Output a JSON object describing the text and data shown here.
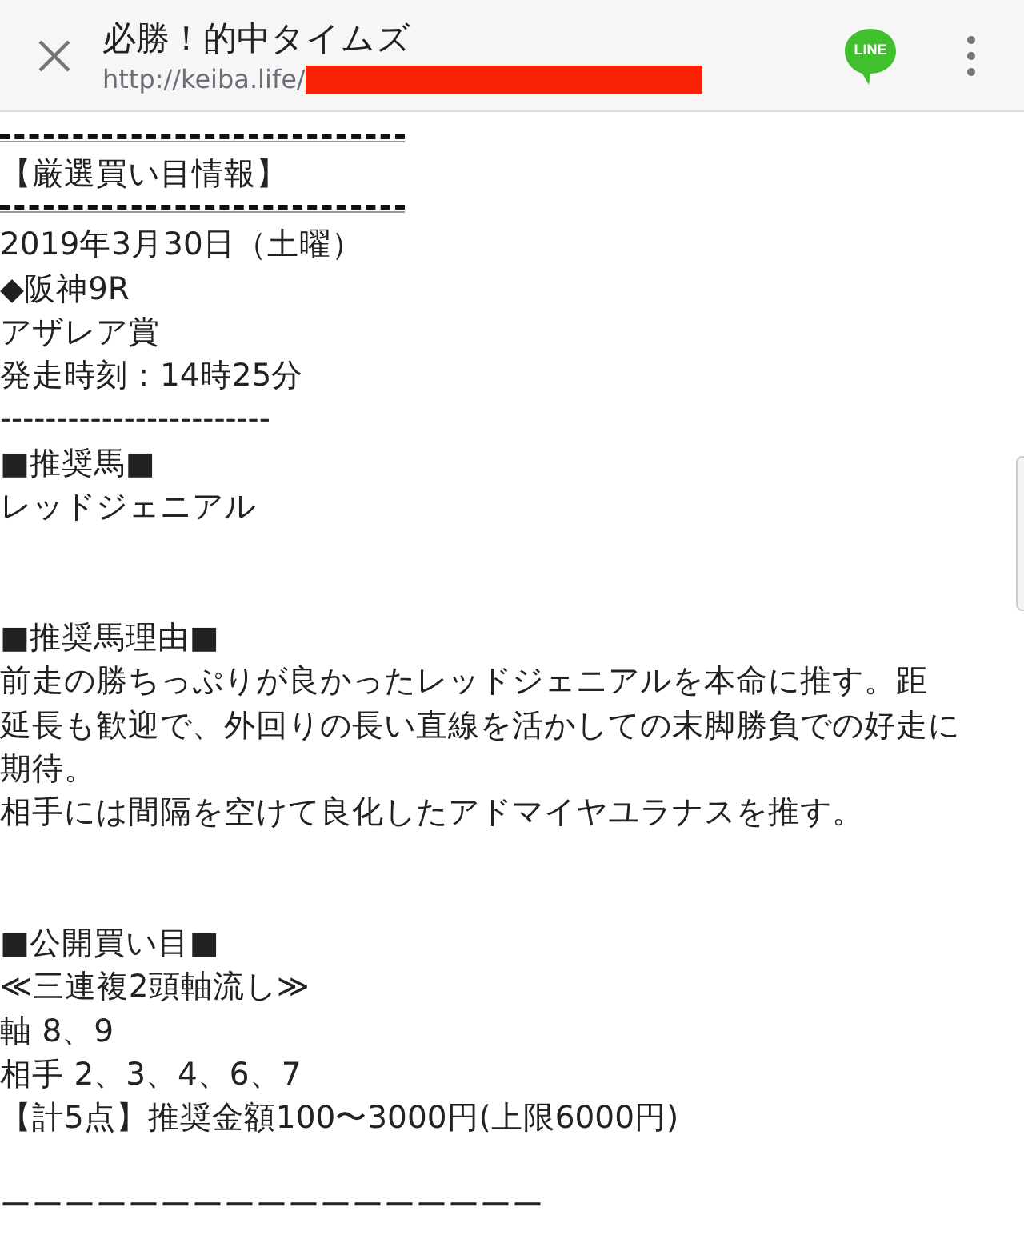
{
  "header": {
    "title": "必勝！的中タイムズ",
    "url": "http://keiba.life/",
    "share_label": "LINE"
  },
  "content": [
    {
      "kind": "dash_rule"
    },
    {
      "kind": "text",
      "text": "【厳選買い目情報】"
    },
    {
      "kind": "dash_rule"
    },
    {
      "kind": "text",
      "text": "2019年3月30日（土曜）"
    },
    {
      "kind": "text",
      "text": "◆阪神9R"
    },
    {
      "kind": "text",
      "text": "アザレア賞"
    },
    {
      "kind": "text",
      "text": "発走時刻：14時25分"
    },
    {
      "kind": "text",
      "text": "------------------------"
    },
    {
      "kind": "text",
      "text": "■推奨馬■"
    },
    {
      "kind": "text",
      "text": "レッドジェニアル"
    },
    {
      "kind": "blank"
    },
    {
      "kind": "blank"
    },
    {
      "kind": "text",
      "text": "■推奨馬理由■"
    },
    {
      "kind": "text",
      "text": "前走の勝ちっぷりが良かったレッドジェニアルを本命に推す。距"
    },
    {
      "kind": "text",
      "text": "延長も歓迎で、外回りの長い直線を活かしての末脚勝負での好走に"
    },
    {
      "kind": "text",
      "text": "期待。"
    },
    {
      "kind": "text",
      "text": "相手には間隔を空けて良化したアドマイヤユラナスを推す。"
    },
    {
      "kind": "blank"
    },
    {
      "kind": "blank"
    },
    {
      "kind": "text",
      "text": "■公開買い目■"
    },
    {
      "kind": "text",
      "text": "≪三連複2頭軸流し≫"
    },
    {
      "kind": "text",
      "text": "軸 8、9"
    },
    {
      "kind": "text",
      "text": "相手 2、3、4、6、7"
    },
    {
      "kind": "text",
      "text": "【計5点】推奨金額100〜3000円(上限6000円)"
    },
    {
      "kind": "blank"
    },
    {
      "kind": "text",
      "text": "ーーーーーーーーーーーーーーーーー"
    }
  ]
}
